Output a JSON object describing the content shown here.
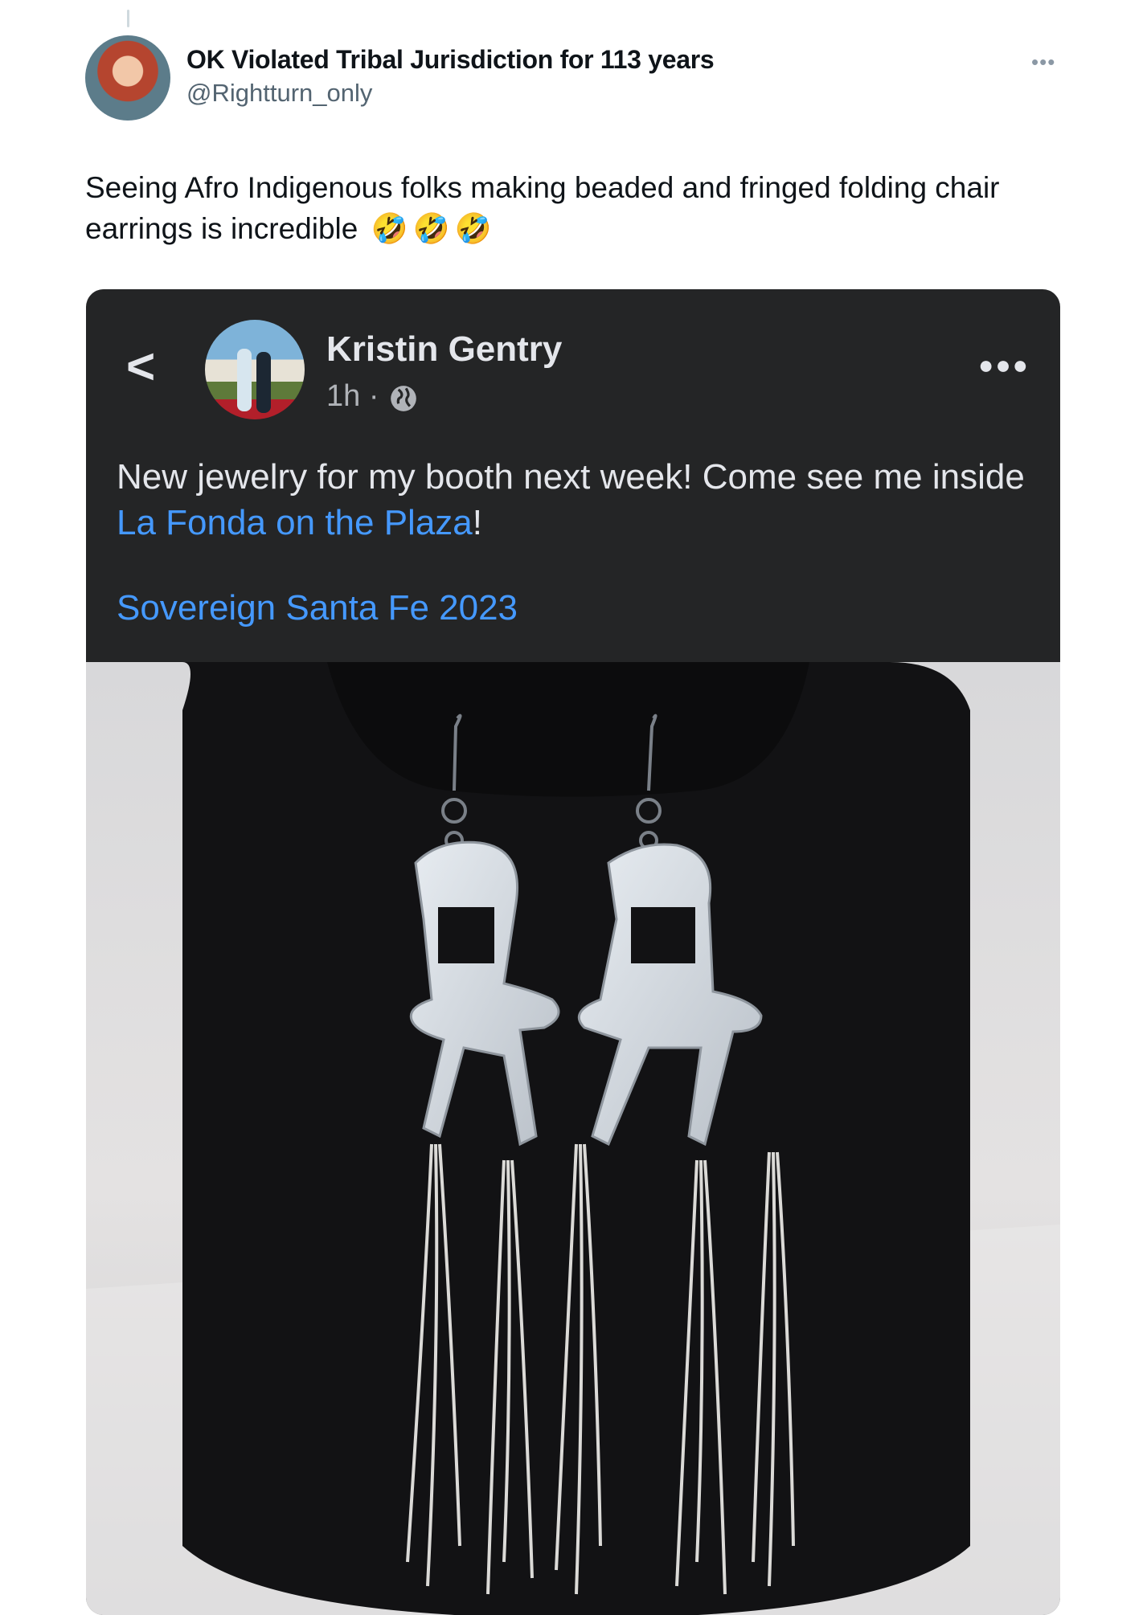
{
  "tweet": {
    "author_name": "OK Violated Tribal Jurisdiction for 113 years",
    "author_handle": "@Rightturn_only",
    "more_icon": "more-horizontal-icon",
    "text": "Seeing Afro Indigenous folks making beaded and fringed folding chair earrings is incredible",
    "emojis": [
      "🤣",
      "🤣",
      "🤣"
    ]
  },
  "embedded_post": {
    "author_name": "Kristin Gentry",
    "time": "1h ·",
    "privacy_icon": "globe-icon",
    "back_icon": "chevron-left-icon",
    "more_icon": "more-horizontal-icon",
    "text_before": "New jewelry for my booth next week! Come see me inside ",
    "link_text": "La Fonda on the Plaza",
    "text_after": "!",
    "hashtag": "Sovereign Santa Fe 2023",
    "colors": {
      "background": "#242526",
      "text": "#e4e6eb",
      "link": "#4599ff"
    }
  }
}
